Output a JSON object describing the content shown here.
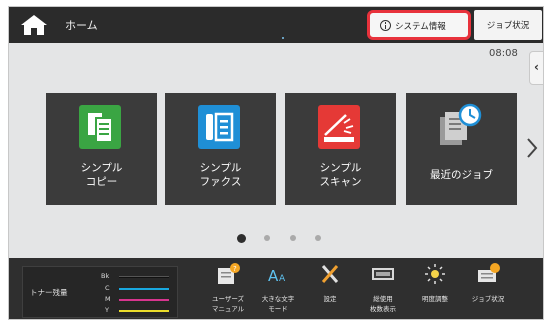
{
  "topbar": {
    "home_label": "ホーム",
    "system_info_label": "システム情報",
    "job_status_label": "ジョブ状況"
  },
  "clock": "08:08",
  "tiles": [
    {
      "line1": "シンプル",
      "line2": "コピー",
      "icon": "simple-copy-icon",
      "color": "#3aa543"
    },
    {
      "line1": "シンプル",
      "line2": "ファクス",
      "icon": "simple-fax-icon",
      "color": "#1f8fd6"
    },
    {
      "line1": "シンプル",
      "line2": "スキャン",
      "icon": "simple-scan-icon",
      "color": "#e53936"
    },
    {
      "line1": "最近のジョブ",
      "line2": "",
      "icon": "recent-jobs-icon",
      "color": "#4a4a4a"
    }
  ],
  "pager": {
    "total": 4,
    "active": 1
  },
  "toner": {
    "label": "トナー残量",
    "rows": [
      {
        "name": "Bk",
        "color": "#111111",
        "level": 1.0
      },
      {
        "name": "C",
        "color": "#19a8df",
        "level": 1.0
      },
      {
        "name": "M",
        "color": "#d7358f",
        "level": 1.0
      },
      {
        "name": "Y",
        "color": "#eadc2a",
        "level": 1.0
      }
    ]
  },
  "bottom_items": [
    {
      "line1": "ユーザーズ",
      "line2": "マニュアル",
      "icon": "user-manual-icon"
    },
    {
      "line1": "大きな文字",
      "line2": "モード",
      "icon": "large-text-icon"
    },
    {
      "line1": "設定",
      "line2": "",
      "icon": "settings-icon"
    },
    {
      "line1": "総使用",
      "line2": "枚数表示",
      "icon": "usage-count-icon"
    },
    {
      "line1": "明度調整",
      "line2": "",
      "icon": "brightness-icon"
    },
    {
      "line1": "ジョブ状況",
      "line2": "",
      "icon": "job-status-icon"
    }
  ],
  "colors": {
    "accent_outline": "#e8323c",
    "tile_bg": "#3b3b3b",
    "topbar_bg": "#2b2b2b"
  }
}
